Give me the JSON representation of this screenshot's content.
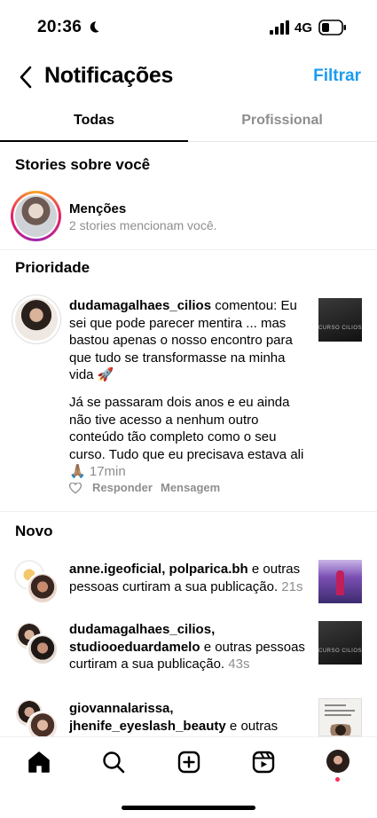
{
  "status_bar": {
    "time": "20:36",
    "network": "4G"
  },
  "header": {
    "title": "Notificações",
    "filter_label": "Filtrar"
  },
  "tabs": [
    {
      "label": "Todas",
      "active": true
    },
    {
      "label": "Profissional",
      "active": false
    }
  ],
  "stories_section": {
    "title": "Stories sobre você",
    "mentions_title": "Menções",
    "mentions_subtitle": "2 stories mencionam você."
  },
  "priority_section": {
    "title": "Prioridade",
    "comment": {
      "username": "dudamagalhaes_cilios",
      "action": " comentou: ",
      "text": "Eu sei que pode parecer mentira ... mas bastou apenas o nosso encontro para que tudo se transformasse na minha vida 🚀",
      "text2": "Já se passaram dois anos e eu ainda não tive acesso a nenhum outro conteúdo tão completo como o seu curso. Tudo que eu precisava estava ali 🙏🏽",
      "time": "17min",
      "thumb_label": "CURSO CILIOS",
      "reply_label": "Responder",
      "message_label": "Mensagem"
    }
  },
  "new_section": {
    "title": "Novo",
    "items": [
      {
        "users": "anne.igeoficial, polparica.bh",
        "rest": " e outras pessoas curtiram a sua publicação.",
        "time": "21s"
      },
      {
        "users": "dudamagalhaes_cilios, studiooeduardamelo",
        "rest": " e outras pessoas curtiram a sua publicação.",
        "time": "43s",
        "thumb_label": "CURSO CILIOS"
      },
      {
        "users": "giovannalarissa, jhenife_eyeslash_beauty",
        "rest": " e outras pessoas curtiram a sua"
      }
    ]
  },
  "bottom_nav": [
    "home-icon",
    "search-icon",
    "create-icon",
    "reels-icon",
    "profile-avatar"
  ],
  "colors": {
    "accent": "#1a9cf0",
    "secondary_text": "#8e8e8e",
    "notification_dot": "#ff2d55"
  }
}
